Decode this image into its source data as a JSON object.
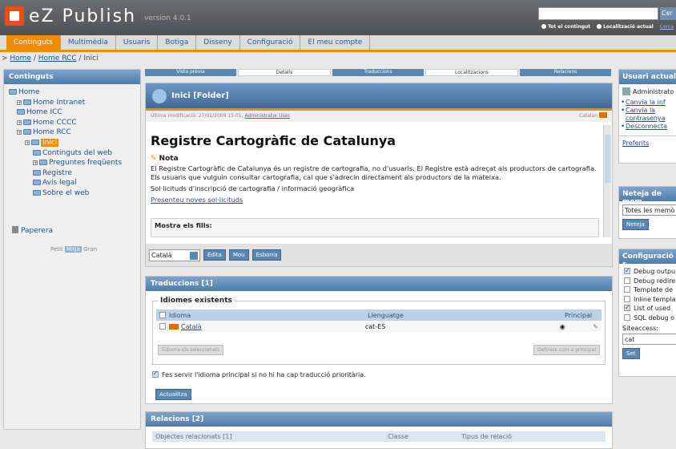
{
  "header": {
    "app_name": "eZ Publish",
    "version": "version 4.0.1",
    "search_button": "Cer",
    "search_options": [
      "Tot el contingut",
      "Localització actual",
      "Cerca"
    ]
  },
  "tabs": [
    "Continguts",
    "Multimèdia",
    "Usuaris",
    "Botiga",
    "Disseny",
    "Configuració",
    "El meu compte"
  ],
  "breadcrumb": {
    "items": [
      "Home",
      "Home RCC"
    ],
    "current": "Inici"
  },
  "left": {
    "title": "Continguts",
    "tree": [
      {
        "label": "Home",
        "indent": 0,
        "plus": false
      },
      {
        "label": "Home Intranet",
        "indent": 1,
        "plus": true
      },
      {
        "label": "Home ICC",
        "indent": 1,
        "plus": false
      },
      {
        "label": "Home CCCC",
        "indent": 1,
        "plus": true
      },
      {
        "label": "Home RCC",
        "indent": 1,
        "plus": true
      },
      {
        "label": "Inici",
        "indent": 2,
        "plus": true,
        "selected": true
      },
      {
        "label": "Continguts del web",
        "indent": 3,
        "plus": false
      },
      {
        "label": "Preguntes freqüents",
        "indent": 3,
        "plus": true
      },
      {
        "label": "Registre",
        "indent": 3,
        "plus": false
      },
      {
        "label": "Avís legal",
        "indent": 3,
        "plus": false
      },
      {
        "label": "Sobre el web",
        "indent": 3,
        "plus": false
      }
    ],
    "trash": "Paperera",
    "sizes": [
      "Petit",
      "Mitjà",
      "Gran"
    ]
  },
  "viewtabs": [
    "Vista prèvia",
    "Detalls",
    "Traduccions",
    "Localitzacions",
    "Relacions"
  ],
  "main": {
    "title": "Inici [Folder]",
    "modified_label": "Última modificació: 27/01/2009 15:01,",
    "modified_user": "Administrator User",
    "language": "Catalan",
    "heading": "Registre Cartogràfic de Catalunya",
    "nota": "Nota",
    "para1": "El Registre Cartogràfic de Catalunya és un registre de cartografia, no d'usuaris. El Registre està adreçat als productors de cartografia.",
    "para2": "Els usuaris que vulguin consultar cartografia, cal que s'adrecin directament als productors de la mateixa.",
    "para3": "Sol·licituds d'inscripció de cartografia / informació geogràfica",
    "link": "Presenteu noves sol·licituds",
    "fills": "Mostra els fills:",
    "select_value": "Català",
    "buttons": [
      "Edita",
      "Mou",
      "Esborra"
    ]
  },
  "translations": {
    "title": "Traduccions [1]",
    "legend": "Idiomes existents",
    "columns": [
      "Idioma",
      "Llenguatge",
      "Principal"
    ],
    "rows": [
      {
        "name": "Català",
        "code": "cat-ES"
      }
    ],
    "remove_btn": "Esborra els seleccionats",
    "primary_btn": "Defineix com a principal",
    "use_primary": "Fes servir l'idioma principal si no hi ha cap traducció prioritària.",
    "update_btn": "Actualitza"
  },
  "relations": {
    "title": "Relacions [2]",
    "columns": [
      "Objectes relacionats [1]",
      "Classe",
      "Tipus de relació"
    ]
  },
  "right": {
    "user_title": "Usuari actual",
    "user_name": "Administrato",
    "links": [
      "Canvia la inf",
      "Canvia la contrasenya",
      "Desconnecta"
    ],
    "prefs": "Preferits",
    "cache_title": "Neteja de mem",
    "cache_select": "Totes les memò",
    "cache_btn": "Neteja",
    "config_title": "Configuració r",
    "config_items": [
      {
        "label": "Debug outpu",
        "checked": true
      },
      {
        "label": "Debug redire",
        "checked": false
      },
      {
        "label": "Template de",
        "checked": false
      },
      {
        "label": "Inline templa",
        "checked": false
      },
      {
        "label": "List of used",
        "checked": true
      },
      {
        "label": "SQL debug o",
        "checked": false
      }
    ],
    "siteaccess_label": "Siteaccess:",
    "siteaccess_value": "cat",
    "set_btn": "Set"
  }
}
